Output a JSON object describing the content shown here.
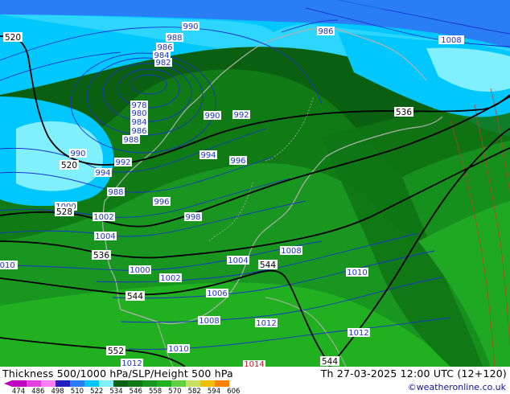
{
  "header": {
    "left_title": "Thickness 500/1000 hPa/SLP/Height 500 hPa",
    "right_title": "Th 27-03-2025 12:00 UTC (12+120)",
    "credit": "©weatheronline.co.uk"
  },
  "legend": {
    "ticks": [
      "474",
      "486",
      "498",
      "510",
      "522",
      "534",
      "546",
      "558",
      "570",
      "582",
      "594",
      "606"
    ],
    "colors": [
      "#c000c0",
      "#e040e0",
      "#ff80ff",
      "#2020c0",
      "#2a7ef5",
      "#00c8ff",
      "#80f0ff",
      "#0a6010",
      "#107a15",
      "#189620",
      "#20b020",
      "#60d040",
      "#c8e060",
      "#f0c000",
      "#ff8000"
    ]
  },
  "colors": {
    "isobar": "#1a33cc",
    "height_contour": "#000000",
    "coast": "#b0b0b0",
    "thick_warm": "#c04020"
  },
  "isobar_labels": [
    "988",
    "986",
    "984",
    "982",
    "990",
    "978",
    "980",
    "984",
    "986",
    "988",
    "990",
    "992",
    "990",
    "992",
    "994",
    "996",
    "994",
    "992",
    "988",
    "1000",
    "1002",
    "1004",
    "996",
    "998",
    "1008",
    "1004",
    "1000",
    "1002",
    "1006",
    "1008",
    "1010",
    "1012",
    "1010",
    "1012",
    "1008",
    "1010",
    "1012",
    "1014",
    "1008",
    "986",
    "1010"
  ],
  "height_labels": [
    "520",
    "520",
    "528",
    "536",
    "536",
    "544",
    "544",
    "552",
    "544",
    "536"
  ]
}
